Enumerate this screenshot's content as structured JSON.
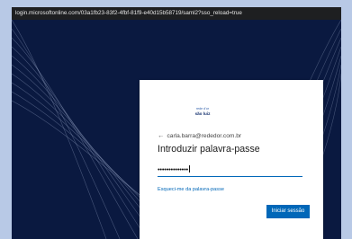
{
  "browser": {
    "url": "login.microsoftonline.com/03a1fb23-83f2-4fbf-81f9-e40d15b58719/saml2?sso_reload=true"
  },
  "signin": {
    "account_email": "carla.barra@rededor.com.br",
    "title": "Introduzir palavra-passe",
    "password_masked": "••••••••••••••",
    "forgot_password_link": "Esqueci-me da palavra-passe",
    "submit_button": "Iniciar sessão"
  },
  "icons": {
    "back": "back-arrow-icon"
  },
  "colors": {
    "page_background": "#0a1940",
    "accent": "#0067b8",
    "card": "#ffffff"
  }
}
